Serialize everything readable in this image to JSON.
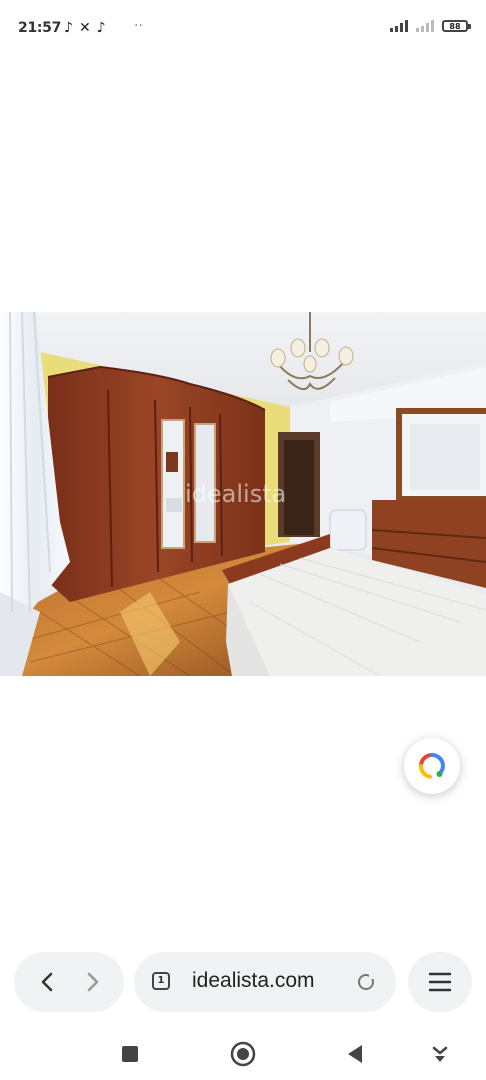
{
  "status_bar": {
    "time": "21:57",
    "left_icons": [
      "tiktok-icon",
      "capcut-icon",
      "tiktok-icon"
    ],
    "more": "··",
    "battery": "88"
  },
  "photo": {
    "alt": "bedroom photo",
    "watermark": "idealista"
  },
  "lens_fab": {
    "icon": "google-lens-icon"
  },
  "browser_bar": {
    "back_icon": "chevron-left-icon",
    "forward_icon": "chevron-right-icon",
    "tab_count": "1",
    "url": "idealista.com",
    "reload_icon": "reload-icon",
    "menu_icon": "hamburger-menu-icon"
  },
  "system_nav": [
    "recents-square-icon",
    "home-circle-icon",
    "back-triangle-icon",
    "keyboard-hide-icon"
  ],
  "colors": {
    "pill_bg": "#f1f2f4",
    "icon": "#444444",
    "lens_blue": "#4285f4"
  }
}
